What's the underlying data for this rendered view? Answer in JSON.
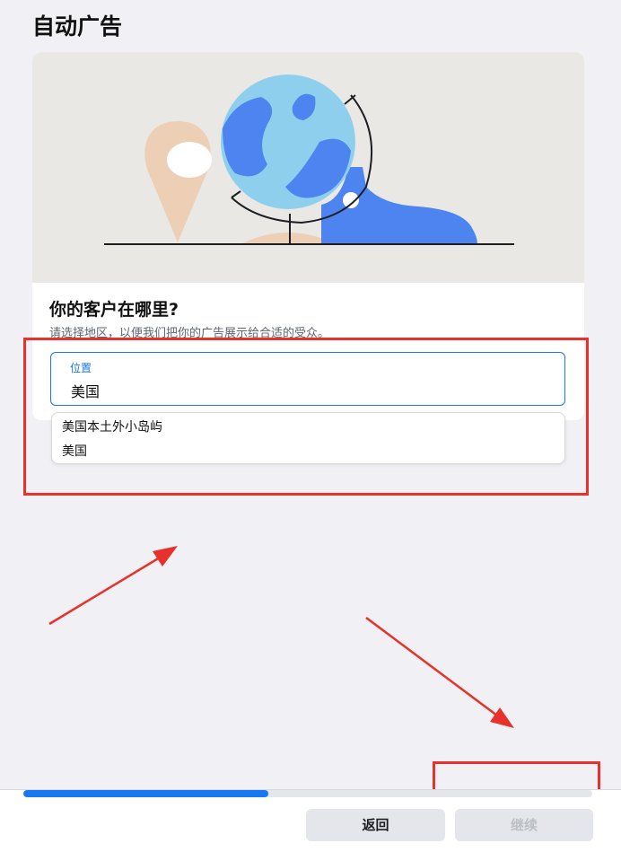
{
  "page": {
    "title": "自动广告"
  },
  "card": {
    "question": "你的客户在哪里?",
    "subtitle": "请选择地区，以便我们把你的广告展示给合适的受众。"
  },
  "location": {
    "label": "位置",
    "value": "美国"
  },
  "dropdown": {
    "options": [
      "美国本土外小岛屿",
      "美国"
    ]
  },
  "footer": {
    "progress": 0.43,
    "back_label": "返回",
    "continue_label": "继续"
  },
  "colors": {
    "accent": "#1877f2",
    "annotation": "#e8312a",
    "illustration_bg": "#e9e8e4",
    "pin": "#eccfb4",
    "globe_ocean": "#8ecfee",
    "globe_land": "#4d84f0",
    "boot": "#4d84f0"
  }
}
